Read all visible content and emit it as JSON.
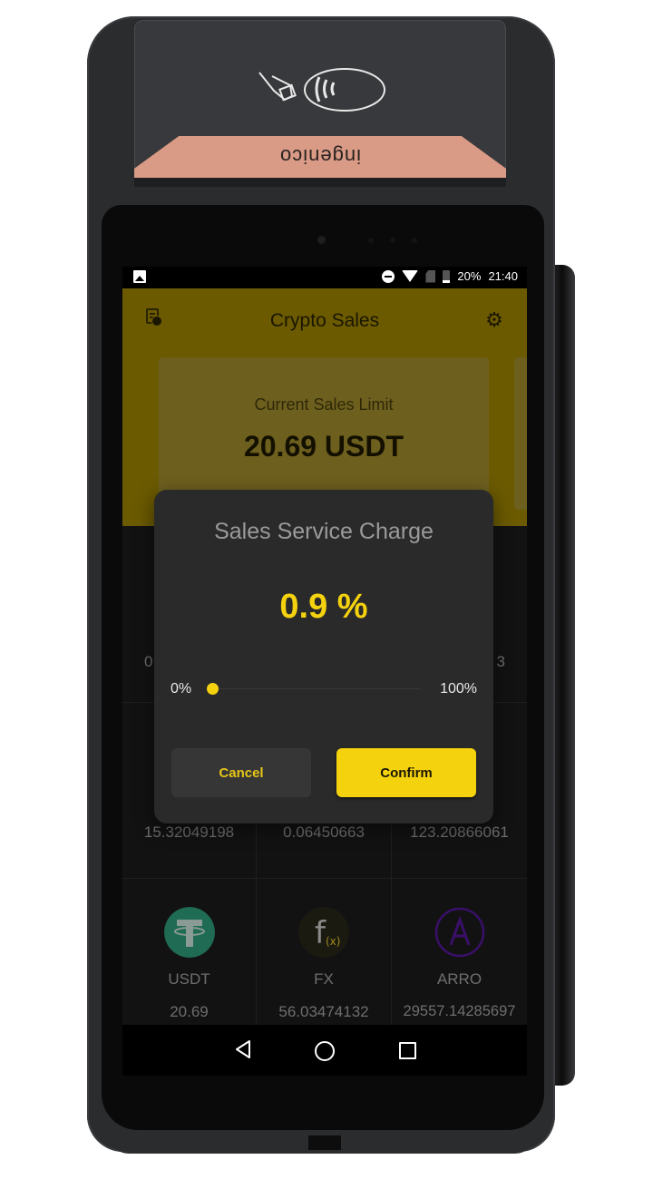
{
  "device": {
    "brand": "ingenico",
    "contactless_symbol": "contactless-payment"
  },
  "status_bar": {
    "left_icon": "image-notification-icon",
    "icons": [
      "do-not-disturb-icon",
      "wifi-icon",
      "no-sim-icon",
      "battery-icon"
    ],
    "battery": "20%",
    "time": "21:40"
  },
  "app": {
    "title": "Crypto Sales",
    "left_icon": "receipt-icon",
    "right_icon": "gear-icon",
    "accent_color": "#f5d20e"
  },
  "limit_card": {
    "label": "Current Sales Limit",
    "value": "20.69 USDT"
  },
  "coins": {
    "row1": [
      {
        "amount": "0"
      },
      {
        "amount": ""
      },
      {
        "amount": "3"
      }
    ],
    "row2": [
      {
        "amount": "15.32049198"
      },
      {
        "amount": "0.06450663"
      },
      {
        "amount": "123.20866061"
      }
    ],
    "row3": [
      {
        "name": "USDT",
        "amount": "20.69",
        "logo": "tether-logo",
        "color": "#26a17b"
      },
      {
        "name": "FX",
        "amount": "56.03474132",
        "logo": "fx-logo",
        "color": "#1a1a10"
      },
      {
        "name": "ARRO",
        "amount": "29557.14285697",
        "logo": "arro-logo",
        "color": "#4a1a7a"
      }
    ]
  },
  "dialog": {
    "title": "Sales Service Charge",
    "value": "0.9 %",
    "slider": {
      "min_label": "0%",
      "max_label": "100%",
      "value_percent": 0.9
    },
    "cancel_label": "Cancel",
    "confirm_label": "Confirm"
  },
  "nav_bar": {
    "buttons": [
      "back",
      "home",
      "recents"
    ]
  }
}
